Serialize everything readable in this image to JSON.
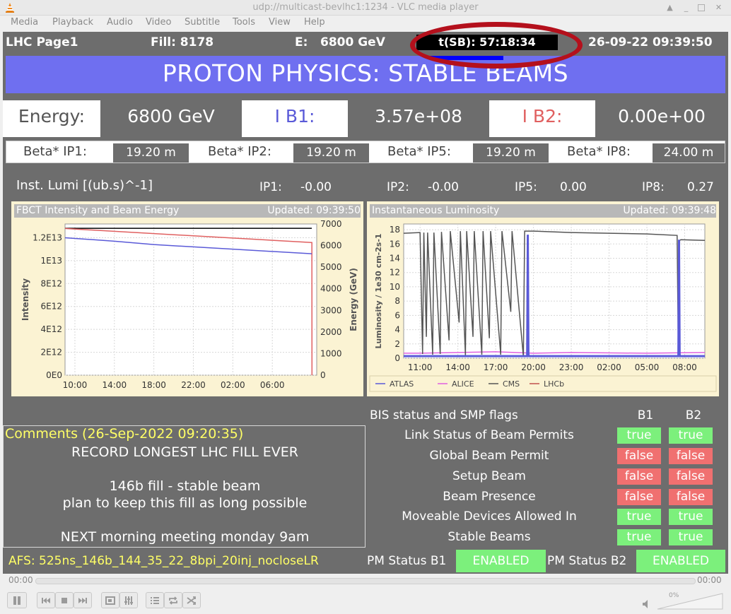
{
  "window": {
    "title": "udp://multicast-bevlhc1:1234 - VLC media player"
  },
  "menu": [
    "Media",
    "Playback",
    "Audio",
    "Video",
    "Subtitle",
    "Tools",
    "View",
    "Help"
  ],
  "header": {
    "page": "LHC Page1",
    "fill": "Fill: 8178",
    "energy_label": "E:",
    "energy_value": "6800 GeV",
    "tsb": "t(SB): 57:18:34",
    "datetime": "26-09-22 09:39:50"
  },
  "banner": "PROTON PHYSICS: STABLE BEAMS",
  "energy_row": {
    "energy_label": "Energy:",
    "energy_value": "6800 GeV",
    "ib1_label": "I B1:",
    "ib1_value": "3.57e+08",
    "ib2_label": "I B2:",
    "ib2_value": "0.00e+00",
    "colors": {
      "b1": "#5a5ad8",
      "b2": "#e06060"
    }
  },
  "beta": [
    {
      "label": "Beta* IP1:",
      "value": "19.20 m"
    },
    {
      "label": "Beta* IP2:",
      "value": "19.20 m"
    },
    {
      "label": "Beta* IP5:",
      "value": "19.20 m"
    },
    {
      "label": "Beta* IP8:",
      "value": "24.00 m"
    }
  ],
  "lumi": {
    "label": "Inst. Lumi [(ub.s)^-1]",
    "ips": [
      {
        "name": "IP1:",
        "value": "-0.00"
      },
      {
        "name": "IP2:",
        "value": "-0.00"
      },
      {
        "name": "IP5:",
        "value": "0.00"
      },
      {
        "name": "IP8:",
        "value": "0.27"
      }
    ]
  },
  "panels": {
    "fbct": {
      "title": "FBCT Intensity and Beam Energy",
      "updated": "Updated: 09:39:50"
    },
    "lumi": {
      "title": "Instantaneous Luminosity",
      "updated": "Updated: 09:39:48"
    }
  },
  "chart_data": [
    {
      "type": "line",
      "title": "",
      "xlabel": "",
      "ylabel": "Intensity",
      "y2label": "Energy (GeV)",
      "x_ticks": [
        "10:00",
        "14:00",
        "18:00",
        "22:00",
        "02:00",
        "06:00"
      ],
      "x_hours": [
        0,
        4,
        8,
        12,
        16,
        20
      ],
      "xlim_hours": [
        -1,
        24.5
      ],
      "y_ticks": [
        "0E0",
        "2E12",
        "4E12",
        "6E12",
        "8E12",
        "1E13",
        "1.2E13"
      ],
      "ylim": [
        0,
        13200000000000.0
      ],
      "y2_ticks": [
        0,
        1000,
        2000,
        3000,
        4000,
        5000,
        6000,
        7000
      ],
      "y2lim": [
        0,
        7000
      ],
      "grid": true,
      "series": [
        {
          "axis": "y2",
          "color": "#000000",
          "x_hours": [
            -1,
            24.0
          ],
          "values": [
            6800,
            6800
          ]
        },
        {
          "axis": "y2",
          "color": "#e06060",
          "x_hours": [
            -1,
            24.0,
            24.01,
            24.02
          ],
          "values": [
            6790,
            6140,
            6140,
            0
          ]
        },
        {
          "axis": "y",
          "color": "#5a5ad8",
          "x_hours": [
            -1,
            4,
            8,
            12,
            16,
            20,
            24.0
          ],
          "values": [
            12000000000000.0,
            11700000000000.0,
            11400000000000.0,
            11200000000000.0,
            11000000000000.0,
            10800000000000.0,
            10600000000000.0
          ]
        }
      ]
    },
    {
      "type": "line",
      "title": "",
      "xlabel": "",
      "ylabel": "Luminosity / 1e30 cm-2s-1",
      "x_ticks": [
        "11:00",
        "14:00",
        "17:00",
        "20:00",
        "23:00",
        "02:00",
        "05:00",
        "08:00"
      ],
      "x_hours": [
        0,
        3,
        6,
        9,
        12,
        15,
        18,
        21
      ],
      "xlim_hours": [
        -1.3,
        22.6
      ],
      "y_ticks": [
        0,
        2,
        4,
        6,
        8,
        10,
        12,
        14,
        16,
        18
      ],
      "ylim": [
        0,
        18.8
      ],
      "grid": true,
      "legend": [
        "ATLAS",
        "ALICE",
        "CMS",
        "LHCb"
      ],
      "legend_position": "bottom",
      "series": [
        {
          "name": "CMS",
          "color": "#555555",
          "x_hours": [
            -1.3,
            0,
            0.2,
            0.3,
            0.5,
            0.6,
            1.0,
            1.1,
            1.6,
            1.7,
            2.3,
            2.4,
            3.1,
            3.2,
            3.6,
            3.7,
            4.2,
            4.3,
            4.9,
            5.0,
            5.5,
            5.6,
            6.4,
            6.5,
            7.2,
            7.3,
            8.2,
            8.3,
            9,
            12,
            15,
            18,
            20.4,
            20.5,
            20.6,
            20.7,
            22.6
          ],
          "values": [
            17.5,
            17.6,
            0.6,
            17.6,
            3,
            17.6,
            0.5,
            17.6,
            0.6,
            17.7,
            2.5,
            17.8,
            5,
            17.8,
            0.4,
            17.8,
            3,
            17.8,
            0.5,
            17.8,
            2.8,
            17.8,
            0.5,
            17.8,
            6.5,
            17.8,
            0.2,
            17.8,
            17.8,
            17.6,
            17.5,
            17.4,
            17.2,
            0.3,
            16.5,
            16.6,
            16.5
          ]
        },
        {
          "name": "ATLAS",
          "color": "#5a5ad8",
          "x_hours": [
            -1.3,
            8.5,
            8.55,
            8.6,
            8.65,
            20.5,
            20.55,
            20.6,
            20.65,
            22.6
          ],
          "values": [
            0.3,
            0.3,
            17.3,
            0.5,
            0.3,
            0.3,
            16.6,
            0.5,
            0.3,
            0.3
          ]
        },
        {
          "name": "ALICE",
          "color": "#e060e0",
          "x_hours": [
            -1.3,
            0,
            6,
            9,
            12,
            18,
            22.6
          ],
          "values": [
            0.7,
            0.7,
            0.9,
            0.7,
            0.8,
            0.7,
            0.8
          ]
        },
        {
          "name": "LHCb",
          "color": "#c0504d",
          "x_hours": [
            -1.3,
            22.6
          ],
          "values": [
            0.3,
            0.3
          ]
        }
      ]
    }
  ],
  "comments": {
    "title": "Comments (26-Sep-2022 09:20:35)",
    "lines": [
      "RECORD LONGEST LHC FILL EVER",
      "146b fill - stable beam",
      "plan to keep this fill as long possible",
      "NEXT morning meeting monday 9am"
    ]
  },
  "bis": {
    "title": "BIS status and SMP flags",
    "col_b1": "B1",
    "col_b2": "B2",
    "rows": [
      {
        "label": "Link Status of Beam Permits",
        "b1": "true",
        "b2": "true"
      },
      {
        "label": "Global Beam Permit",
        "b1": "false",
        "b2": "false"
      },
      {
        "label": "Setup Beam",
        "b1": "false",
        "b2": "false"
      },
      {
        "label": "Beam Presence",
        "b1": "false",
        "b2": "false"
      },
      {
        "label": "Moveable Devices Allowed In",
        "b1": "true",
        "b2": "true"
      },
      {
        "label": "Stable Beams",
        "b1": "true",
        "b2": "true"
      }
    ]
  },
  "footer": {
    "afs": "AFS: 525ns_146b_144_35_22_8bpi_20inj_nocloseLR",
    "pm_b1_label": "PM Status B1",
    "pm_b1_value": "ENABLED",
    "pm_b2_label": "PM Status B2",
    "pm_b2_value": "ENABLED"
  },
  "player": {
    "time_elapsed": "00:00",
    "time_total": "00:00",
    "volume": "0%",
    "buttons": [
      "pause-icon",
      "previous-icon",
      "stop-icon",
      "next-icon",
      "fullscreen-icon",
      "equalizer-icon",
      "playlist-icon",
      "loop-icon",
      "shuffle-icon",
      "speaker-icon"
    ]
  }
}
